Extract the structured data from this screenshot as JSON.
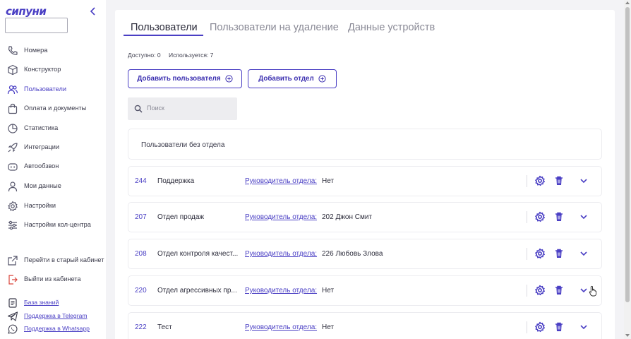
{
  "sidebar": {
    "logo": "сипуни",
    "search_value": "",
    "items": [
      {
        "label": "Номера",
        "icon": "phone-icon"
      },
      {
        "label": "Конструктор",
        "icon": "cube-icon"
      },
      {
        "label": "Пользователи",
        "icon": "users-icon",
        "active": true
      },
      {
        "label": "Оплата и документы",
        "icon": "bag-icon"
      },
      {
        "label": "Статистика",
        "icon": "pie-chart-icon"
      },
      {
        "label": "Интеграции",
        "icon": "rocket-icon"
      },
      {
        "label": "Автообзвон",
        "icon": "robot-icon"
      },
      {
        "label": "Мои данные",
        "icon": "user-icon"
      },
      {
        "label": "Настройки",
        "icon": "gear-icon"
      },
      {
        "label": "Настройки кол-центра",
        "icon": "sliders-icon"
      }
    ],
    "bottom": [
      {
        "label": "Перейти в старый кабинет",
        "icon": "external-link-icon"
      },
      {
        "label": "Выйти из кабинета",
        "icon": "logout-icon"
      }
    ],
    "links": [
      {
        "label": "База знаний",
        "icon": "document-icon"
      },
      {
        "label": "Поддержка в Telegram",
        "icon": "telegram-icon"
      },
      {
        "label": "Поддержка в Whatsapp",
        "icon": "whatsapp-icon"
      }
    ]
  },
  "tabs": [
    {
      "label": "Пользователи",
      "active": true
    },
    {
      "label": "Пользователи на удаление"
    },
    {
      "label": "Данные устройств"
    }
  ],
  "stats": {
    "available": "Доступно: 0",
    "used": "Используется: 7"
  },
  "buttons": {
    "add_user": "Добавить пользователя",
    "add_department": "Добавить отдел"
  },
  "search": {
    "placeholder": "Поиск"
  },
  "no_department": "Пользователи без отдела",
  "departments": [
    {
      "id": "244",
      "name": "Поддержка",
      "head_label": "Руководитель отдела:",
      "head": "Нет"
    },
    {
      "id": "207",
      "name": "Отдел продаж",
      "head_label": "Руководитель отдела:",
      "head": "202 Джон Смит"
    },
    {
      "id": "208",
      "name": "Отдел контроля качест...",
      "head_label": "Руководитель отдела:",
      "head": "226 Любовь Злова"
    },
    {
      "id": "220",
      "name": "Отдел агрессивных пр...",
      "head_label": "Руководитель отдела:",
      "head": "Нет"
    },
    {
      "id": "222",
      "name": "Тест",
      "head_label": "Руководитель отдела:",
      "head": "Нет"
    }
  ],
  "colors": {
    "accent": "#4a3fc4",
    "background": "#f3f3f6",
    "card": "#ffffff"
  }
}
